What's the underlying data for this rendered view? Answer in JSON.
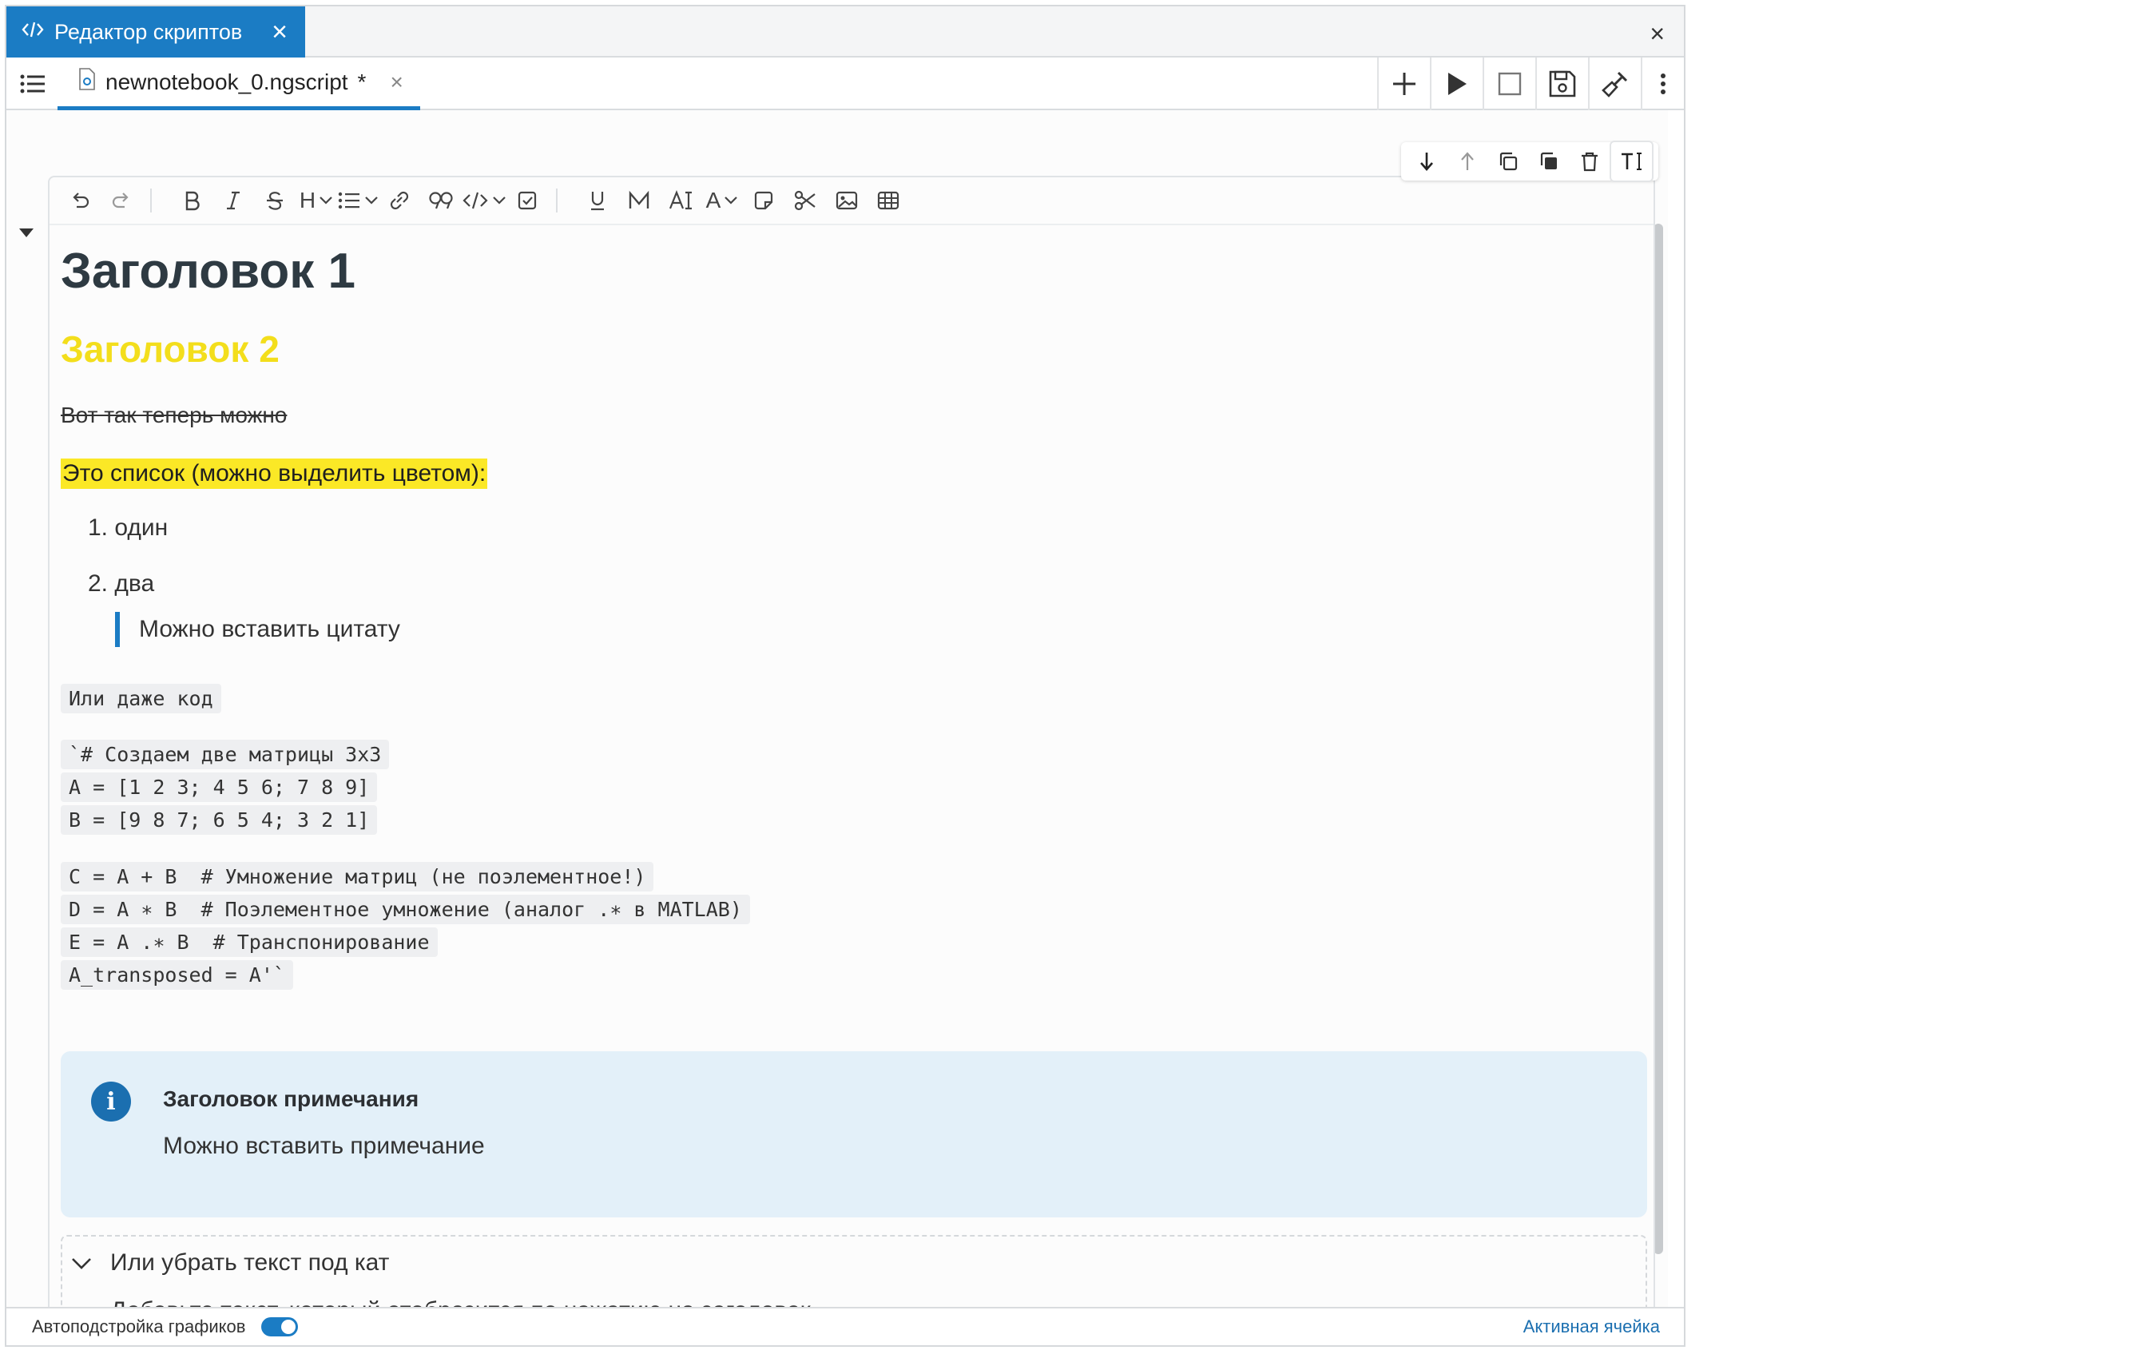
{
  "window": {
    "editor_tab_label": "Редактор скриптов",
    "file_tab_label": "newnotebook_0.ngscript",
    "file_tab_modified": "*"
  },
  "toolbar_icons": [
    "undo-icon",
    "redo-icon",
    "bold-icon",
    "italic-icon",
    "strikethrough-icon",
    "heading-icon",
    "list-icon",
    "link-icon",
    "quote-icon",
    "code-icon",
    "checkbox-icon",
    "underline-icon",
    "math-icon",
    "text-size-icon",
    "font-color-icon",
    "note-icon",
    "scissors-icon",
    "image-icon",
    "table-icon"
  ],
  "toolbar_glyphs": {
    "heading": "H",
    "font_color": "A"
  },
  "cell_action_icons": [
    "move-down-icon",
    "move-up-icon",
    "duplicate-icon",
    "copy-icon",
    "delete-icon",
    "text-cell-icon"
  ],
  "document": {
    "heading1": "Заголовок 1",
    "heading2": "Заголовок 2",
    "strike_text": "Вот так теперь можно",
    "highlight_text": "Это список (можно выделить цветом):",
    "list_items": [
      "1. один",
      "2. два"
    ],
    "quote": "Можно вставить цитату",
    "inline_code": "Или даже код",
    "code_block_1": [
      "`# Создаем две матрицы 3x3",
      "A = [1 2 3; 4 5 6; 7 8 9]",
      "B = [9 8 7; 6 5 4; 3 2 1]"
    ],
    "code_block_2": [
      "C = A + B  # Умножение матриц (не поэлементное!)",
      "D = A ∗ B  # Поэлементное умножение (аналог .∗ в MATLAB)",
      "E = A .∗ B  # Транспонирование",
      "A_transposed = A'`"
    ],
    "note_title": "Заголовок примечания",
    "note_text": "Можно вставить примечание",
    "cut_title": "Или убрать текст под кат",
    "cut_text": "Добавьте текст, который отобразится по нажатию на заголовок"
  },
  "statusbar": {
    "autoplot_label": "Автоподстройка графиков",
    "autoplot_on": true,
    "active_cell": "Активная ячейка"
  },
  "colors": {
    "accent": "#1b7cc4",
    "heading2": "#f3de1c",
    "highlight": "#fbe826",
    "note_bg": "#e3f0f9"
  }
}
